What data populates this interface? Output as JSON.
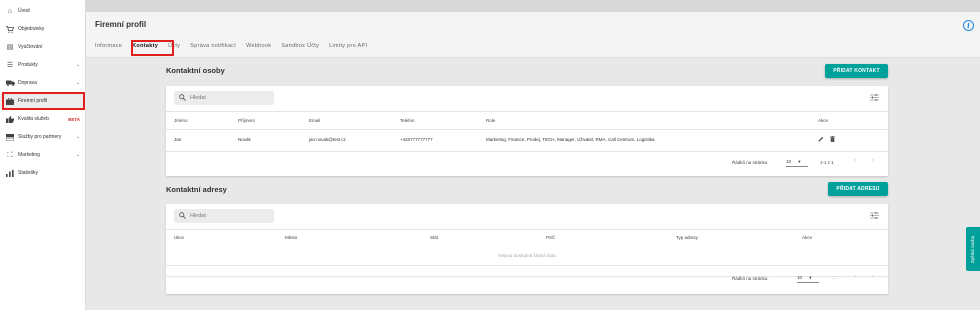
{
  "sidebar": {
    "items": [
      {
        "label": "Úvod",
        "icon": "home-icon",
        "glyph": "⌂"
      },
      {
        "label": "Objednávky",
        "icon": "cart-icon",
        "glyph": "🛒"
      },
      {
        "label": "Vyúčtování",
        "icon": "invoice-icon",
        "glyph": "▤"
      },
      {
        "label": "Produkty",
        "icon": "list-icon",
        "glyph": "☰",
        "chevron": "⌄"
      },
      {
        "label": "Doprava",
        "icon": "truck-icon",
        "glyph": "⛟",
        "chevron": "⌄"
      },
      {
        "label": "Firemní profil",
        "icon": "briefcase-icon",
        "glyph": "▣"
      },
      {
        "label": "Kvalita služeb",
        "icon": "thumbs-up-icon",
        "glyph": "👍",
        "badge": "BETA"
      },
      {
        "label": "Služby pro partnery",
        "icon": "services-icon",
        "glyph": "▭",
        "chevron": "⌄"
      },
      {
        "label": "Marketing",
        "icon": "marketing-icon",
        "glyph": "⛶",
        "chevron": "⌄"
      },
      {
        "label": "Statistiky",
        "icon": "bar-chart-icon",
        "glyph": "▮"
      }
    ]
  },
  "header": {
    "title": "Firemní profil",
    "tabs": [
      "Informace",
      "Kontakty",
      "Účty",
      "Správa notifikací",
      "Webhook",
      "Sandbox Účty",
      "Limity pro API"
    ],
    "active_tab": "Kontakty"
  },
  "contacts": {
    "title": "Kontaktní osoby",
    "add_label": "PŘIDAT KONTAKT",
    "search_placeholder": "Hledat",
    "columns": [
      "Jméno",
      "Příjmení",
      "Email",
      "Telefon",
      "Role",
      "Akce"
    ],
    "rows": [
      {
        "first": "Jan",
        "last": "Novák",
        "email": "jan.novak@test.cz",
        "phone": "+420777777777",
        "role": "Marketing, Finance, Prodej, TECH, Manager, Uživatel, RMA, Call Centrum, Logistika"
      }
    ],
    "pagination": {
      "rows_label": "Řádků na stránku:",
      "per_page": "10",
      "range": "1-1 z 1"
    }
  },
  "addresses": {
    "title": "Kontaktní adresy",
    "add_label": "PŘIDAT ADRESU",
    "search_placeholder": "Hledat",
    "columns": [
      "Ulice",
      "Město",
      "Stát",
      "PSČ",
      "Typ adresy",
      "Akce"
    ],
    "empty": "Nejsou dostupná žádná data",
    "pagination": {
      "rows_label": "Řádků na stránku:",
      "per_page": "10",
      "range": "-"
    }
  },
  "side_tab": "Zpětná vazba",
  "colors": {
    "accent": "#00a19a",
    "highlight": "#e02020",
    "info": "#1e88e5",
    "beta": "#d32f2f"
  }
}
